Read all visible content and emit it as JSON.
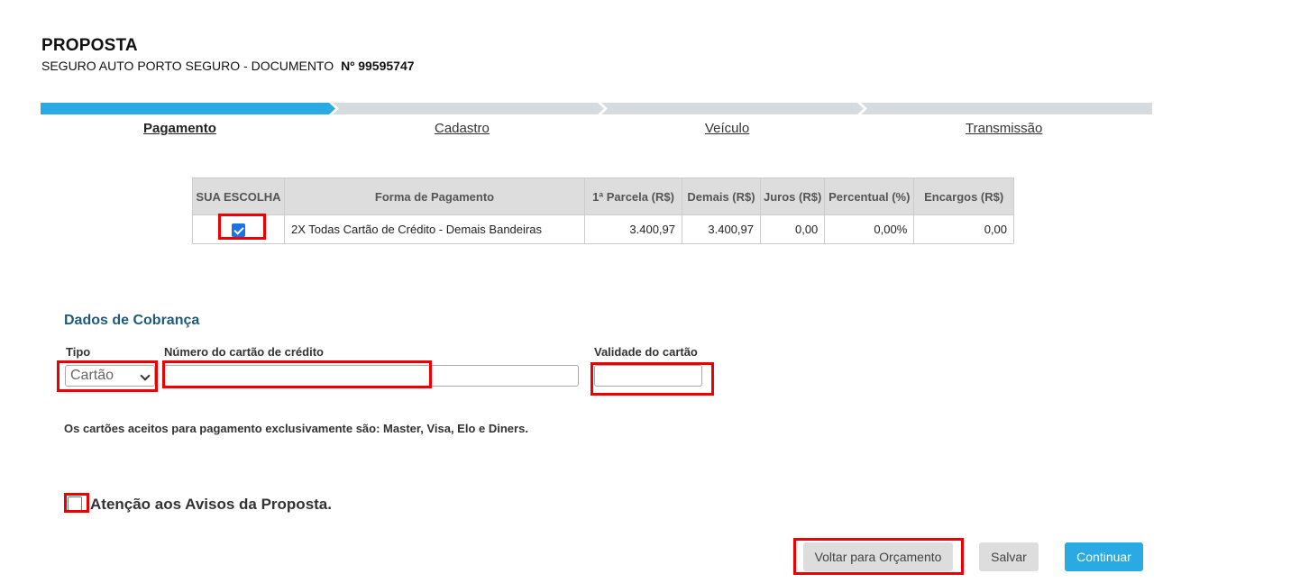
{
  "header": {
    "title": "PROPOSTA",
    "subtitle": "SEGURO AUTO PORTO SEGURO - DOCUMENTO",
    "doc_number": "Nº 99595747"
  },
  "steps": [
    {
      "label": "Pagamento",
      "active": true
    },
    {
      "label": "Cadastro",
      "active": false
    },
    {
      "label": "Veículo",
      "active": false
    },
    {
      "label": "Transmissão",
      "active": false
    }
  ],
  "colors": {
    "step_active": "#29aae3",
    "step_inactive": "#d6dbe0",
    "highlight": "#e00000",
    "section_title": "#1f5a7a"
  },
  "payment_table": {
    "headers": [
      "SUA ESCOLHA",
      "Forma de Pagamento",
      "1ª Parcela (R$)",
      "Demais (R$)",
      "Juros (R$)",
      "Percentual (%)",
      "Encargos (R$)"
    ],
    "rows": [
      {
        "selected": true,
        "forma": "2X Todas Cartão de Crédito - Demais Bandeiras",
        "primeira": "3.400,97",
        "demais": "3.400,97",
        "juros": "0,00",
        "percentual": "0,00%",
        "encargos": "0,00"
      }
    ]
  },
  "cobranca": {
    "title": "Dados de Cobrança",
    "tipo_label": "Tipo",
    "tipo_value": "Cartão",
    "numero_label": "Número do cartão de crédito",
    "numero_value": "",
    "validade_label": "Validade do cartão",
    "validade_value": "",
    "note": "Os cartões aceitos para pagamento exclusivamente são: Master, Visa, Elo e Diners."
  },
  "aviso": {
    "label": "Atenção aos Avisos da Proposta.",
    "checked": false
  },
  "buttons": {
    "voltar": "Voltar para Orçamento",
    "salvar": "Salvar",
    "continuar": "Continuar"
  }
}
